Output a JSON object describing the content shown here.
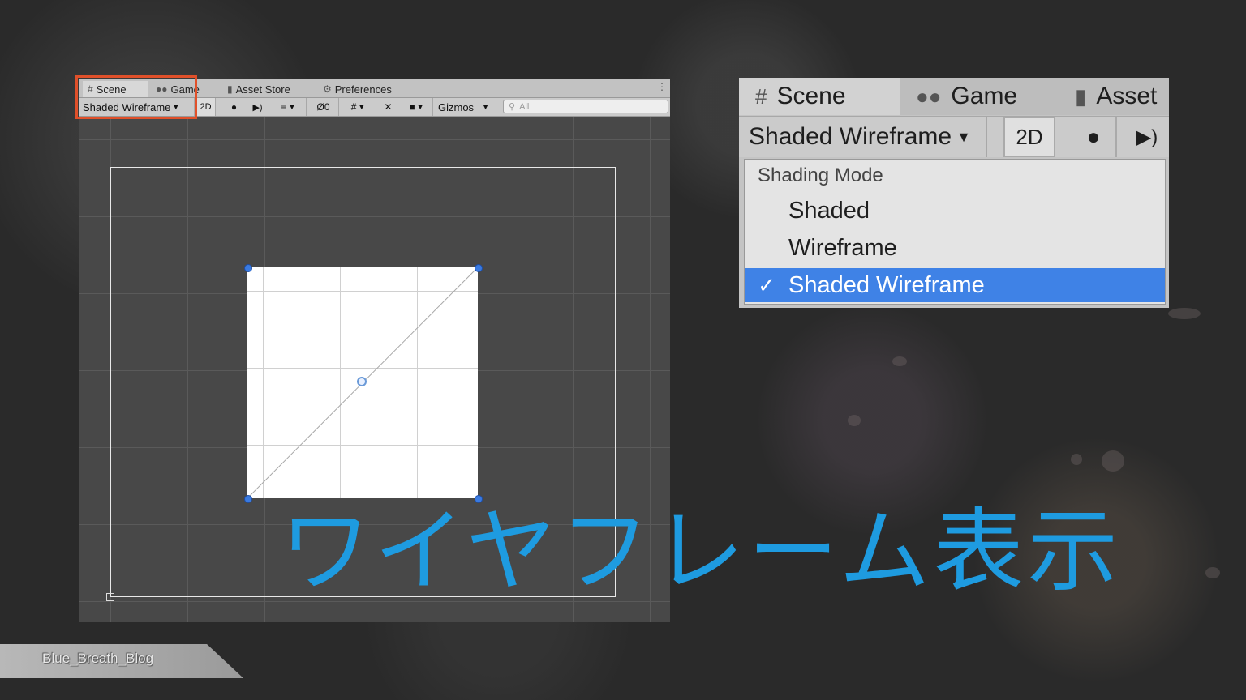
{
  "scene_window": {
    "tabs": {
      "scene": "Scene",
      "game": "Game",
      "asset_store": "Asset Store",
      "preferences": "Preferences"
    },
    "toolbar": {
      "shading_mode": "Shaded Wireframe",
      "mode_2d": "2D",
      "hidden_count": "0",
      "gizmos": "Gizmos",
      "search_placeholder": "All"
    },
    "icons": [
      "grid-hash-icon",
      "gamepad-icon",
      "shopping-bag-icon",
      "gear-icon",
      "lightbulb-icon",
      "audio-icon",
      "effects-icon",
      "hidden-eye-icon",
      "grid-snap-icon",
      "tools-icon",
      "camera-icon",
      "search-icon"
    ]
  },
  "zoom_panel": {
    "tabs": {
      "scene": "Scene",
      "game": "Game",
      "asset": "Asset"
    },
    "toolbar": {
      "shading_mode": "Shaded Wireframe",
      "mode_2d": "2D"
    },
    "menu": {
      "header": "Shading Mode",
      "items": [
        {
          "label": "Shaded",
          "checked": false
        },
        {
          "label": "Wireframe",
          "checked": false
        },
        {
          "label": "Shaded Wireframe",
          "checked": true
        }
      ],
      "check_mark": "✓"
    },
    "colors": {
      "selection": "#3f82e6",
      "highlight_box": "#e0502a"
    }
  },
  "caption": "ワイヤフレーム表示",
  "banner": "Blue_Breath_Blog",
  "colors": {
    "caption": "#1e9be0"
  }
}
